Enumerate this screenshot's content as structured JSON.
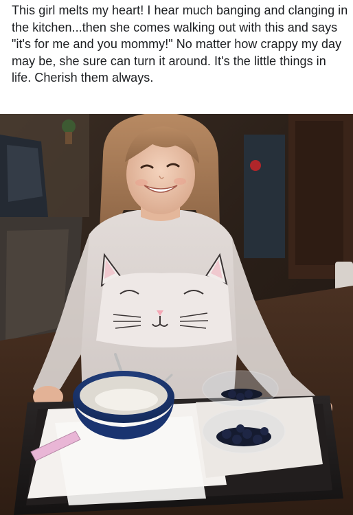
{
  "post": {
    "text": "This girl melts my heart! I hear much banging and clanging in the kitchen...then she comes walking out with this and says \"it's for me and you mommy!\" No matter how crappy my day may be, she sure can turn it around. It's the little things in life. Cherish them always."
  },
  "photo": {
    "alt": ""
  }
}
